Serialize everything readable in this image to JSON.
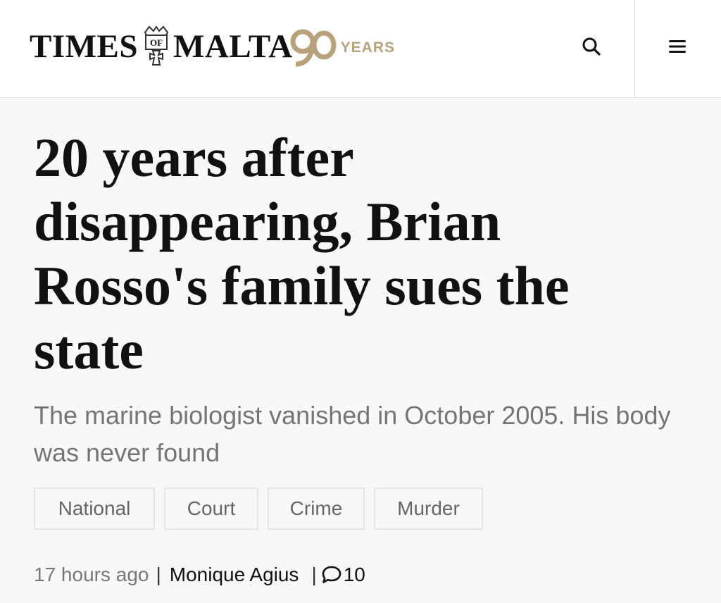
{
  "header": {
    "logo": {
      "word_left": "TIMES",
      "crest_text": "OF",
      "word_right": "MALTA",
      "anniversary_number": "90",
      "anniversary_label": "YEARS",
      "gold_color": "#b8a27c"
    },
    "search_icon": "search-icon",
    "menu_icon": "hamburger-menu-icon"
  },
  "article": {
    "headline": "20 years after disappearing, Brian Rosso's family sues the state",
    "subheadline": "The marine biologist vanished in October 2005. His body was never found",
    "tags": [
      "National",
      "Court",
      "Crime",
      "Murder"
    ],
    "meta": {
      "time": "17 hours ago",
      "separator": "|",
      "author": "Monique Agius",
      "comment_count": "10",
      "comment_icon": "comment-bubble-icon"
    }
  }
}
